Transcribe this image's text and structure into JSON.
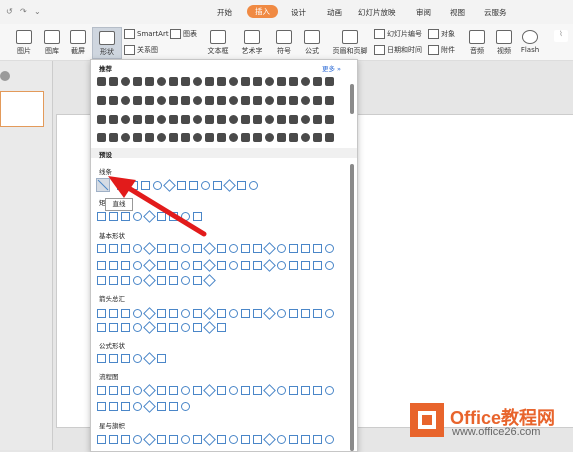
{
  "menubar": {
    "quick_access": [
      "↺",
      "↷",
      "⌄"
    ],
    "tabs": [
      "开始",
      "插入",
      "设计",
      "动画",
      "幻灯片放映",
      "审阅",
      "视图",
      "云服务"
    ],
    "active_tab": "插入"
  },
  "ribbon": {
    "picture": "图片",
    "gallery": "图库",
    "screenshot": "截屏",
    "shapes": "形状",
    "smartart": "SmartArt",
    "chart": "图表",
    "relation": "关系图",
    "textbox": "文本框",
    "wordart": "艺术字",
    "symbol": "符号",
    "formula": "公式",
    "header_footer": "页眉和页脚",
    "slide_number": "幻灯片编号",
    "object": "对象",
    "date_time": "日期和时间",
    "attachment": "附件",
    "audio": "音频",
    "video": "视频",
    "flash": "Flash"
  },
  "dropdown": {
    "recommended": "推荐",
    "more": "更多 »",
    "presets": "预设",
    "lines": "线条",
    "rectangle": "矩",
    "basic_shapes": "基本形状",
    "arrows": "箭头总汇",
    "formula_shapes": "公式形状",
    "flowchart": "流程图",
    "stars": "星与旗帜"
  },
  "tooltip": "直线",
  "watermark": {
    "brand": "Office教程网",
    "url": "www.office26.com"
  }
}
